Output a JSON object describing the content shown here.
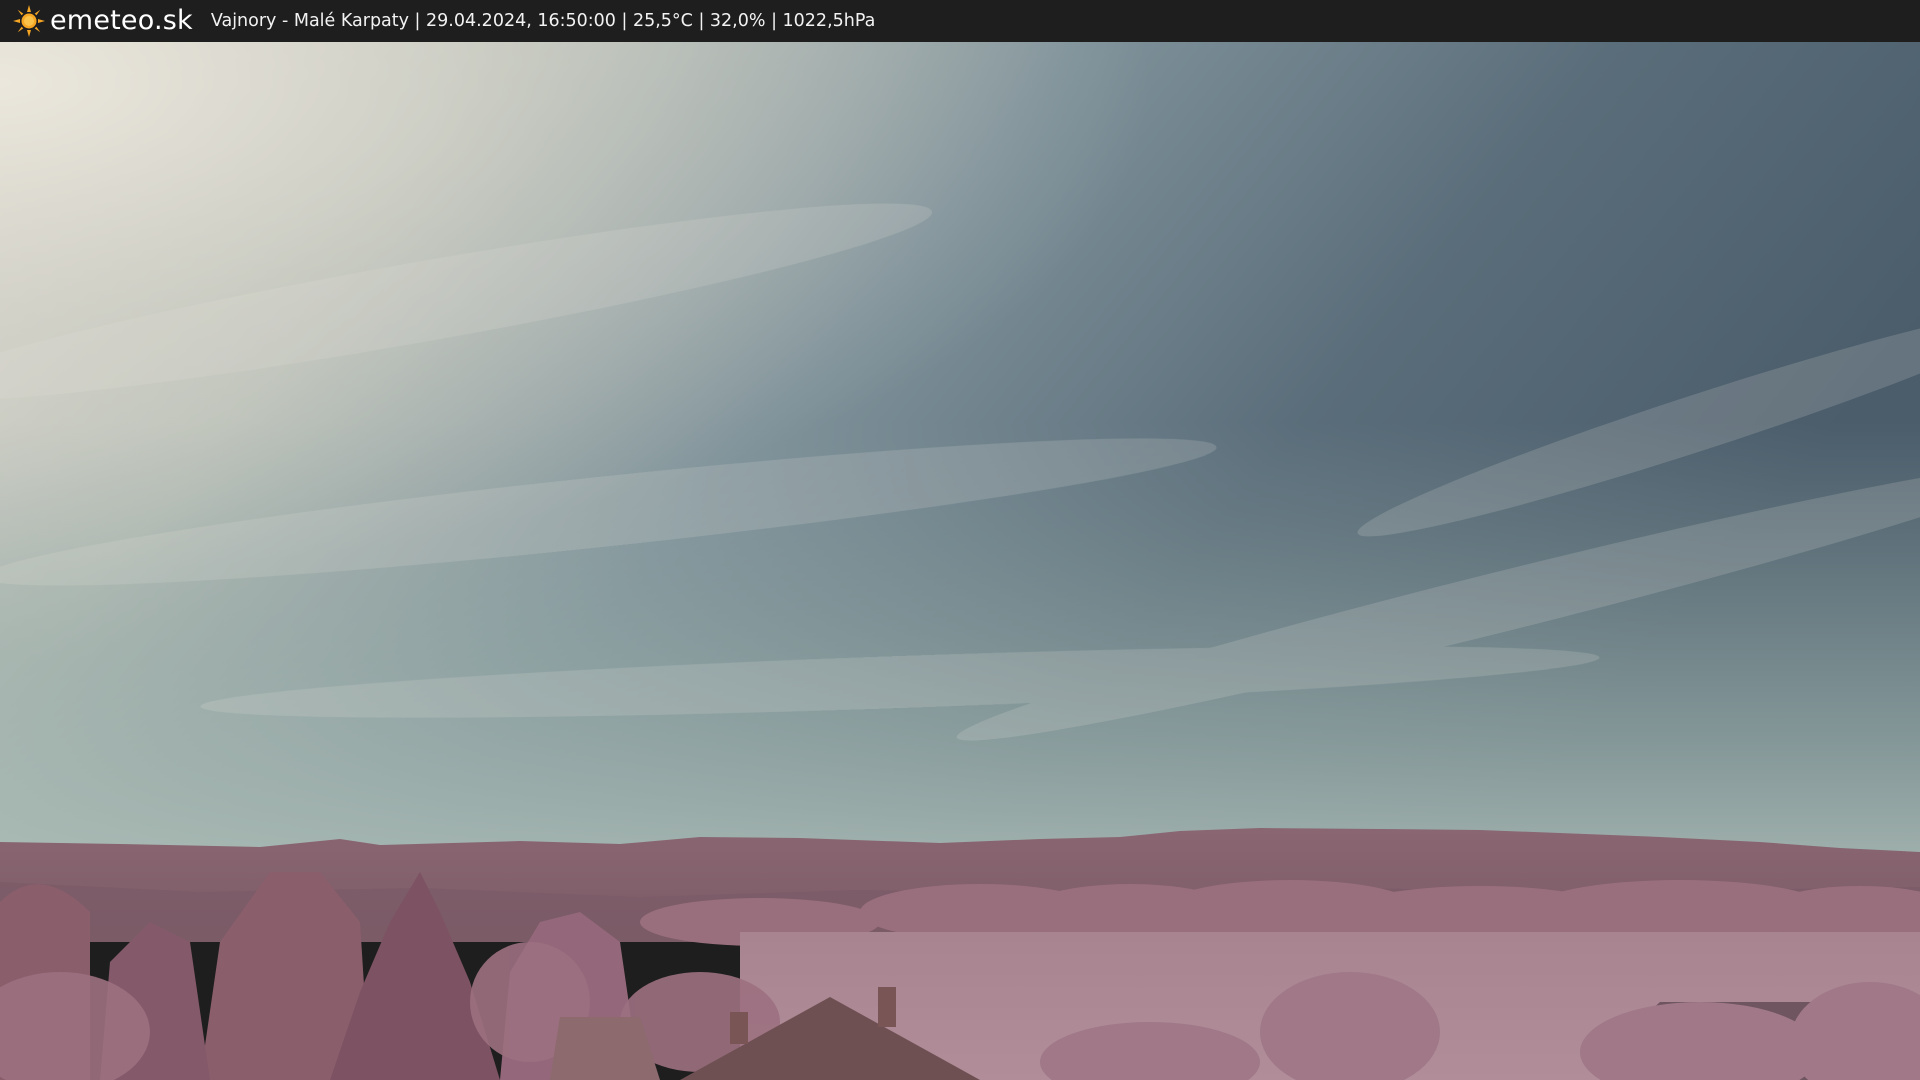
{
  "header": {
    "logo_text": "emeteo.sk",
    "logo_icon": "sun-icon",
    "caption": "Vajnory - Malé Karpaty | 29.04.2024, 16:50:00 | 25,5°C | 32,0% | 1022,5hPa"
  },
  "colors": {
    "bar_background": "#1e1e1e",
    "sun_orange": "#f5a623",
    "sky_light": "#d8d6cc",
    "sky_dark": "#4a5e6e",
    "foliage_pink": "#a0707e"
  }
}
